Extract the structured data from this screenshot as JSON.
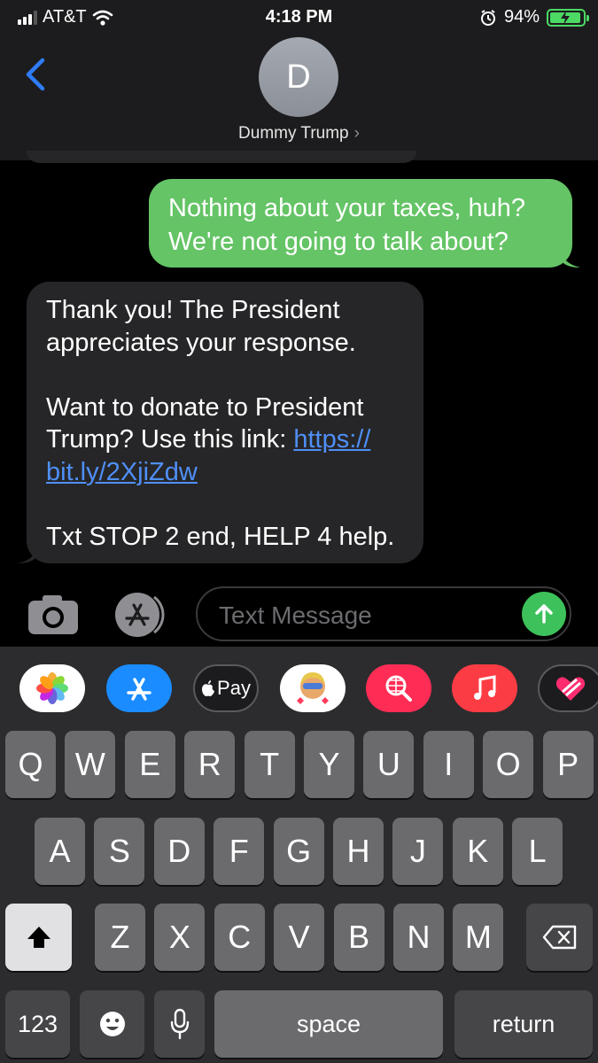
{
  "status": {
    "carrier": "AT&T",
    "time": "4:18 PM",
    "battery": "94%"
  },
  "header": {
    "avatar_initial": "D",
    "contact_name": "Dummy Trump",
    "chevron": "›"
  },
  "messages": {
    "outgoing": {
      "line1": "Nothing about your taxes, huh?",
      "line2": "We're not going to talk about?"
    },
    "incoming": {
      "l1": "Thank you! The President",
      "l2": "appreciates your response.",
      "l3": "Want to donate to President",
      "l4_prefix": "Trump? Use this link: ",
      "link_part1": "https://",
      "link_part2": "bit.ly/2XjiZdw",
      "l5": "Txt STOP 2 end, HELP 4 help."
    }
  },
  "input": {
    "placeholder": "Text Message"
  },
  "apps": {
    "applepay_label": "Pay"
  },
  "keyboard": {
    "row1": [
      "Q",
      "W",
      "E",
      "R",
      "T",
      "Y",
      "U",
      "I",
      "O",
      "P"
    ],
    "row2": [
      "A",
      "S",
      "D",
      "F",
      "G",
      "H",
      "J",
      "K",
      "L"
    ],
    "row3": [
      "Z",
      "X",
      "C",
      "V",
      "B",
      "N",
      "M"
    ],
    "num": "123",
    "space": "space",
    "return": "return"
  },
  "colors": {
    "outgoing_bubble": "#65c466",
    "incoming_bubble": "#262628",
    "link": "#4f8ff7",
    "accent_blue": "#2f7cf6",
    "send": "#3dc15a"
  },
  "icons": [
    "back-chevron-icon",
    "camera-icon",
    "app-store-icon",
    "send-arrow-icon",
    "photos-icon",
    "memoji-icon",
    "web-search-icon",
    "music-icon",
    "heart-sticker-icon",
    "shift-icon",
    "delete-icon",
    "emoji-icon",
    "microphone-icon",
    "alarm-icon",
    "wifi-icon",
    "battery-icon"
  ]
}
